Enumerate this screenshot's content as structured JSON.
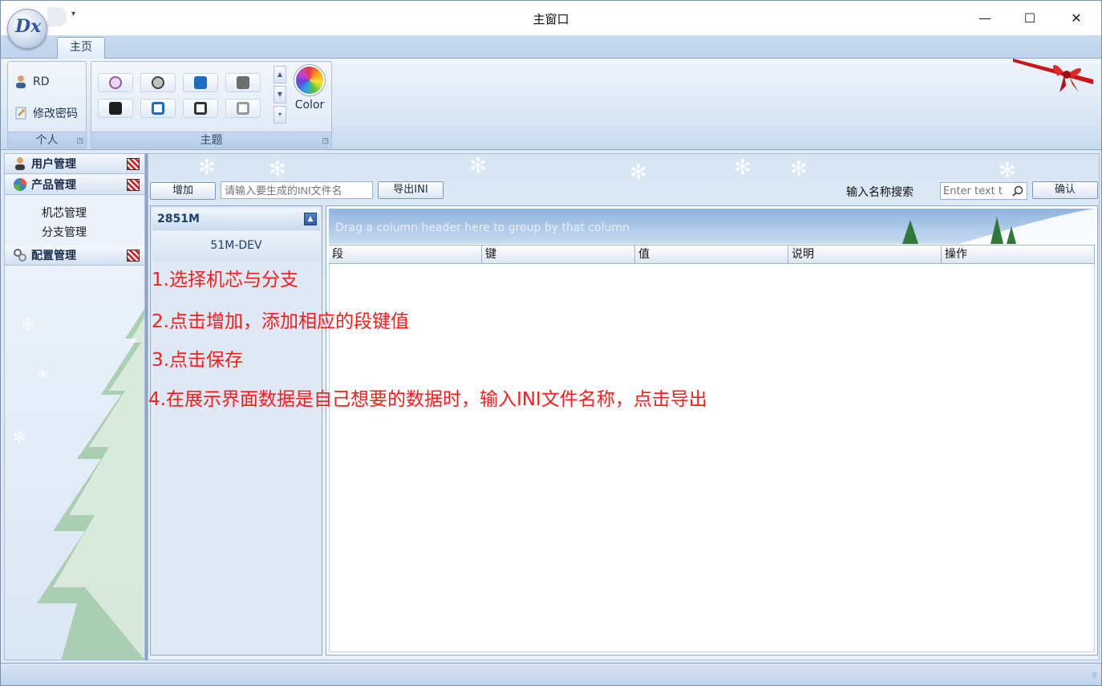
{
  "window": {
    "title": "主窗口",
    "minimize": "—",
    "maximize": "☐",
    "close": "✕",
    "orb_text": "Dx",
    "qat_arrow": "▾"
  },
  "ribbon": {
    "tab": "主页",
    "groups": {
      "personal": {
        "label": "个人",
        "items": [
          "RD",
          "修改密码"
        ]
      },
      "theme": {
        "label": "主题",
        "color_label": "Color"
      }
    }
  },
  "nav": {
    "sections": [
      {
        "label": "用户管理"
      },
      {
        "label": "产品管理",
        "items": [
          "机芯管理",
          "分支管理"
        ]
      },
      {
        "label": "配置管理"
      }
    ]
  },
  "toolbar": {
    "add_label": "增加",
    "ini_placeholder": "请输入要生成的INI文件名",
    "export_label": "导出INI",
    "search_label": "输入名称搜索",
    "search_placeholder": "Enter text t",
    "confirm_label": "确认"
  },
  "list": {
    "header": "2851M",
    "item": "51M-DEV"
  },
  "grid": {
    "group_hint": "Drag a column header here to group by that column",
    "columns": [
      "段",
      "键",
      "值",
      "说明",
      "操作"
    ]
  },
  "notes": [
    "1.选择机芯与分支",
    "2.点击增加，添加相应的段键值",
    "3.点击保存",
    "4.在展示界面数据是自己想要的数据时，输入INI文件名称，点击导出"
  ],
  "icons": {
    "user": "user-icon",
    "key": "key-icon",
    "product": "product-icon",
    "config": "gears-icon",
    "palette": "color-palette-icon",
    "search": "search-icon"
  },
  "colors": {
    "accent": "#2d5aa8",
    "annotation": "#ff1a1a",
    "ribbon_bg": "#dce8f5"
  }
}
